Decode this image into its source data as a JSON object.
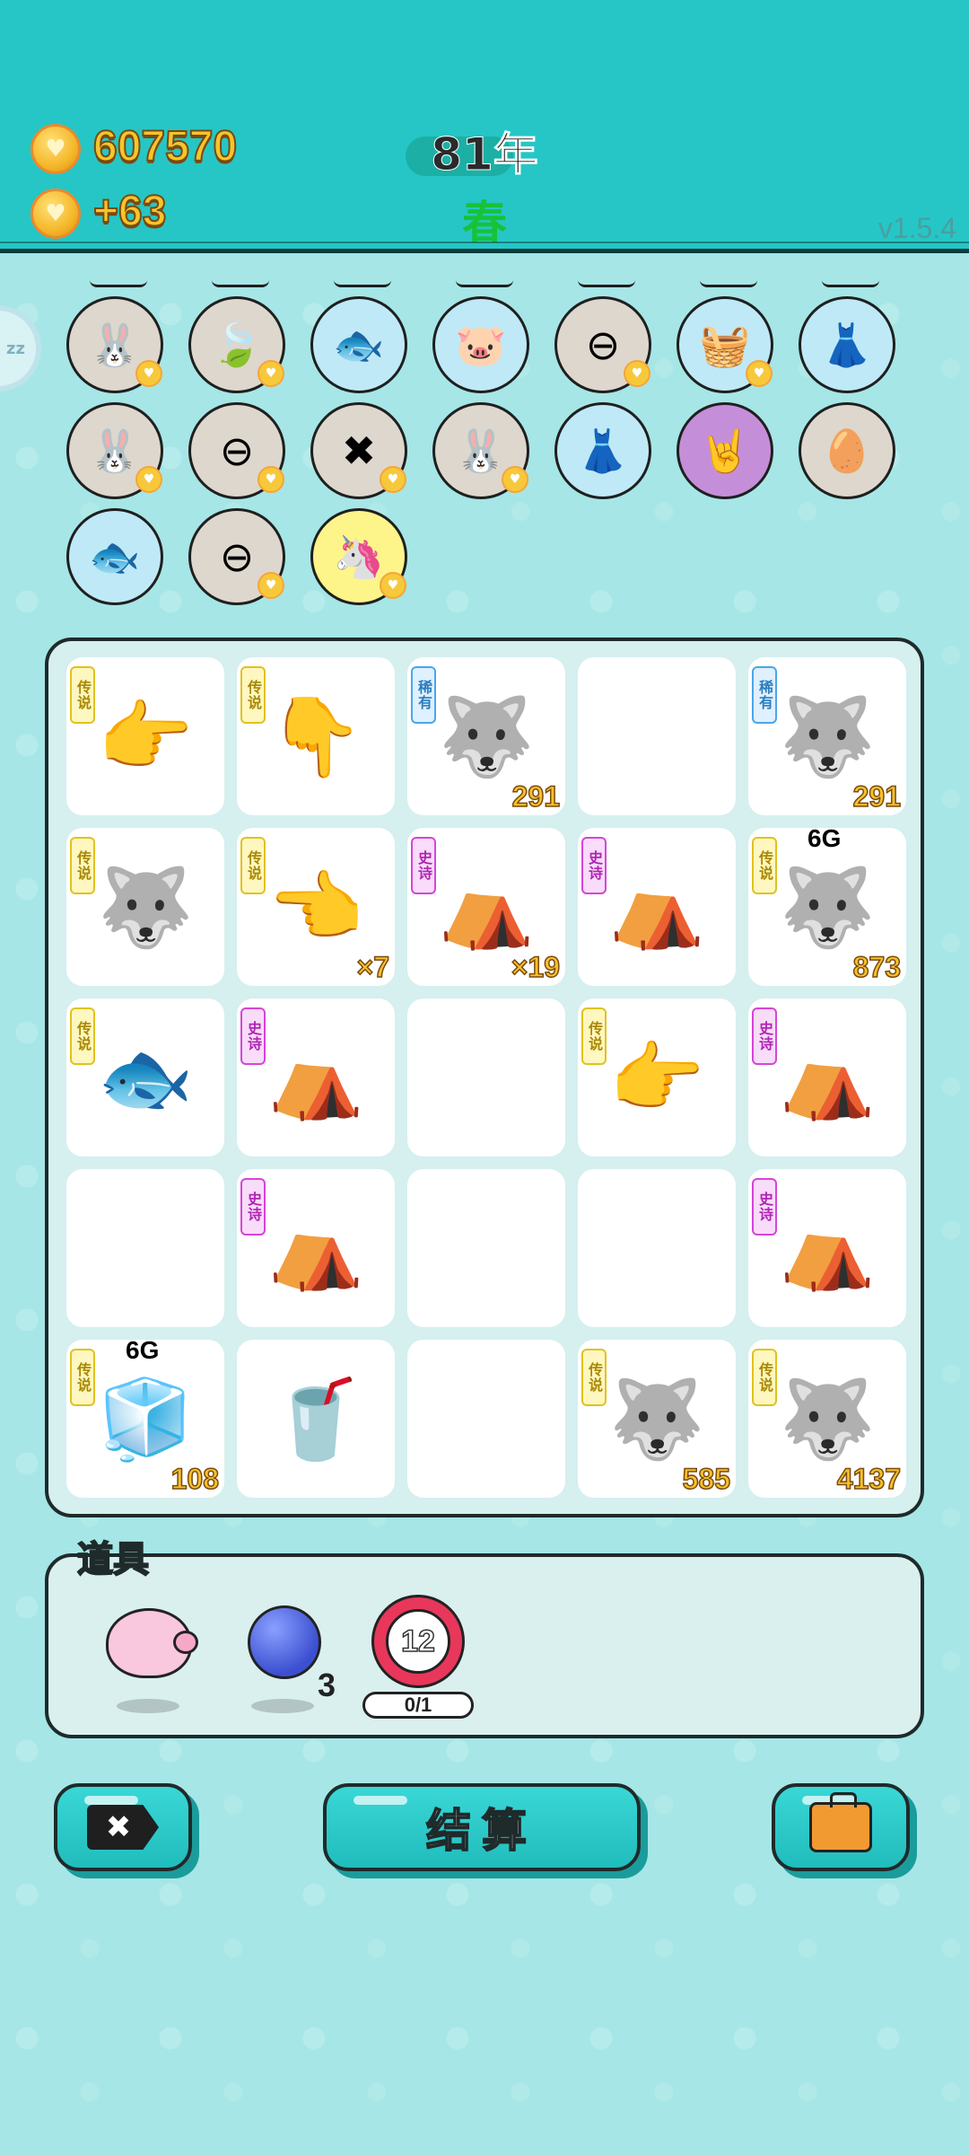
{
  "header": {
    "coins": "607570",
    "income": "+63",
    "year": "81年",
    "season": "春",
    "version": "v1.5.4"
  },
  "collection": [
    {
      "icon": "🐰",
      "bg": "gray",
      "heart": true
    },
    {
      "icon": "🍃",
      "bg": "gray",
      "heart": true
    },
    {
      "icon": "🐟",
      "bg": "blue",
      "heart": false
    },
    {
      "icon": "🐷",
      "bg": "blue",
      "heart": false
    },
    {
      "icon": "⊖",
      "bg": "gray",
      "heart": true
    },
    {
      "icon": "🧺",
      "bg": "blue",
      "heart": true
    },
    {
      "icon": "👗",
      "bg": "blue",
      "heart": false
    },
    {
      "icon": "🐰",
      "bg": "gray",
      "heart": true
    },
    {
      "icon": "⊖",
      "bg": "gray",
      "heart": true
    },
    {
      "icon": "✖",
      "bg": "gray",
      "heart": true
    },
    {
      "icon": "🐰",
      "bg": "gray",
      "heart": true
    },
    {
      "icon": "👗",
      "bg": "blue",
      "heart": false
    },
    {
      "icon": "🤘",
      "bg": "purple",
      "heart": false
    },
    {
      "icon": "🥚",
      "bg": "gray",
      "heart": false
    },
    {
      "icon": "🐟",
      "bg": "blue",
      "heart": false
    },
    {
      "icon": "⊖",
      "bg": "gray",
      "heart": true
    },
    {
      "icon": "🦄",
      "bg": "yellow",
      "heart": true
    }
  ],
  "board": [
    [
      {
        "rarity": "传说",
        "rclass": "legend",
        "icon": "👉",
        "num": ""
      },
      {
        "rarity": "传说",
        "rclass": "legend",
        "icon": "👇",
        "num": ""
      },
      {
        "rarity": "稀有",
        "rclass": "rare",
        "icon": "🐺",
        "num": "291"
      },
      {
        "rarity": "",
        "rclass": "",
        "icon": "",
        "num": ""
      },
      {
        "rarity": "稀有",
        "rclass": "rare",
        "icon": "🐺",
        "num": "291"
      }
    ],
    [
      {
        "rarity": "传说",
        "rclass": "legend",
        "icon": "🐺",
        "num": ""
      },
      {
        "rarity": "传说",
        "rclass": "legend",
        "icon": "👈",
        "num": "×7"
      },
      {
        "rarity": "史诗",
        "rclass": "epic",
        "icon": "⛺",
        "num": "×19"
      },
      {
        "rarity": "史诗",
        "rclass": "epic",
        "icon": "⛺",
        "num": ""
      },
      {
        "rarity": "传说",
        "rclass": "legend",
        "icon": "🐺",
        "num": "873",
        "tag": "6G"
      }
    ],
    [
      {
        "rarity": "传说",
        "rclass": "legend",
        "icon": "🐟",
        "num": ""
      },
      {
        "rarity": "史诗",
        "rclass": "epic",
        "icon": "⛺",
        "num": ""
      },
      {
        "rarity": "",
        "rclass": "",
        "icon": "",
        "num": ""
      },
      {
        "rarity": "传说",
        "rclass": "legend",
        "icon": "👉",
        "num": ""
      },
      {
        "rarity": "史诗",
        "rclass": "epic",
        "icon": "⛺",
        "num": ""
      }
    ],
    [
      {
        "rarity": "",
        "rclass": "",
        "icon": "",
        "num": ""
      },
      {
        "rarity": "史诗",
        "rclass": "epic",
        "icon": "⛺",
        "num": ""
      },
      {
        "rarity": "",
        "rclass": "",
        "icon": "",
        "num": ""
      },
      {
        "rarity": "",
        "rclass": "",
        "icon": "",
        "num": ""
      },
      {
        "rarity": "史诗",
        "rclass": "epic",
        "icon": "⛺",
        "num": ""
      }
    ],
    [
      {
        "rarity": "传说",
        "rclass": "legend",
        "icon": "🧊",
        "num": "108",
        "tag": "6G"
      },
      {
        "rarity": "",
        "rclass": "",
        "icon": "🥤",
        "num": ""
      },
      {
        "rarity": "",
        "rclass": "",
        "icon": "",
        "num": ""
      },
      {
        "rarity": "传说",
        "rclass": "legend",
        "icon": "🐺",
        "num": "585"
      },
      {
        "rarity": "传说",
        "rclass": "legend",
        "icon": "🐺",
        "num": "4137"
      }
    ]
  ],
  "props": {
    "title": "道具",
    "blue_ball_count": "3",
    "timer_value": "12",
    "timer_progress": "0/1"
  },
  "buttons": {
    "settle_label": "结算"
  },
  "colors": {
    "header_bg": "#26c6c6",
    "body_bg": "#a6e6e6",
    "coin_text": "#f6c52b",
    "season_green": "#18c238"
  }
}
